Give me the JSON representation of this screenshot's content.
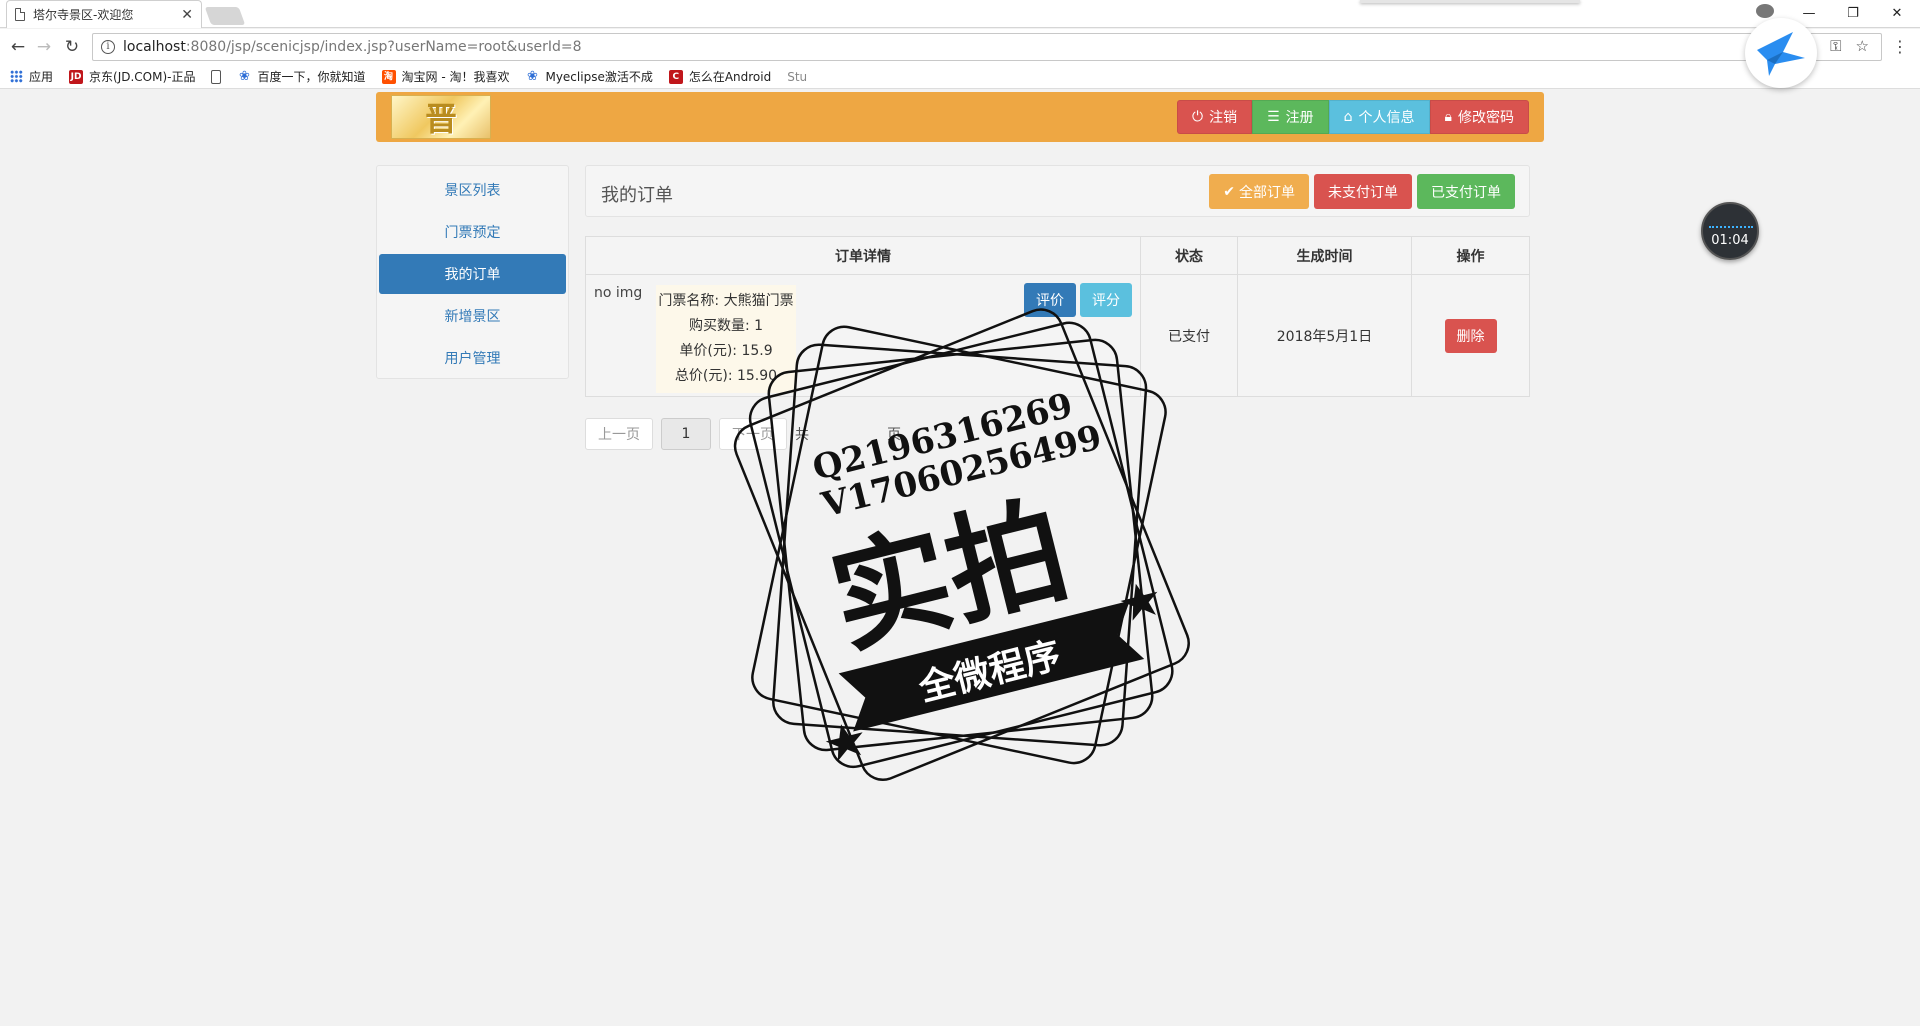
{
  "browser": {
    "tab_title": "塔尔寺景区-欢迎您",
    "url_host": "localhost",
    "url_rest": ":8080/jsp/scenicjsp/index.jsp?userName=root&userId=8",
    "bookmarks": [
      {
        "label": "应用",
        "icon": "apps-grid-icon",
        "color": "#2f6fd6"
      },
      {
        "label": "京东(JD.COM)-正品",
        "icon": "jd-icon",
        "color": "#c0161b"
      },
      {
        "label": "",
        "icon": "page-icon",
        "color": "#555555"
      },
      {
        "label": "百度一下，你就知道",
        "icon": "baidu-paw-icon",
        "color": "#2f6fd6"
      },
      {
        "label": "淘宝网 - 淘！我喜欢",
        "icon": "taobao-icon",
        "color": "#ff5000"
      },
      {
        "label": "Myeclipse激活不成",
        "icon": "baidu-paw-icon",
        "color": "#2f6fd6"
      },
      {
        "label": "怎么在Android",
        "icon": "c-icon",
        "color": "#c0161b"
      },
      {
        "label": "Stu",
        "icon": "",
        "color": ""
      }
    ]
  },
  "widgets": {
    "timer": "01:04"
  },
  "header": {
    "logo_text": "晋",
    "actions": [
      {
        "label": "注销",
        "icon": "power-icon",
        "style": "b-danger"
      },
      {
        "label": "注册",
        "icon": "list-icon",
        "style": "b-success"
      },
      {
        "label": "个人信息",
        "icon": "home-icon",
        "style": "b-info"
      },
      {
        "label": "修改密码",
        "icon": "lock-icon",
        "style": "b-danger"
      }
    ]
  },
  "sidebar": {
    "items": [
      {
        "label": "景区列表",
        "active": false
      },
      {
        "label": "门票预定",
        "active": false
      },
      {
        "label": "我的订单",
        "active": true
      },
      {
        "label": "新增景区",
        "active": false
      },
      {
        "label": "用户管理",
        "active": false
      }
    ]
  },
  "main": {
    "title": "我的订单",
    "filters": [
      {
        "label": "全部订单",
        "icon": "check-icon",
        "style": "b-warning"
      },
      {
        "label": "未支付订单",
        "icon": "",
        "style": "b-danger"
      },
      {
        "label": "已支付订单",
        "icon": "",
        "style": "b-success"
      }
    ],
    "table": {
      "headers": [
        "订单详情",
        "状态",
        "生成时间",
        "操作"
      ],
      "rows": [
        {
          "img_alt": "no img",
          "detail_lines": [
            "门票名称: 大熊猫门票",
            "购买数量: 1",
            "单价(元): 15.9",
            "总价(元): 15.90"
          ],
          "review_label": "评价",
          "rate_label": "评分",
          "status": "已支付",
          "created": "2018年5月1日",
          "delete_label": "删除"
        }
      ]
    },
    "pager": {
      "prev": "上一页",
      "current": "1",
      "next": "下一页",
      "total_prefix": "共",
      "total_suffix": "页"
    }
  },
  "watermark": {
    "line1": "Q2196316269",
    "line2": "V17060256499",
    "big": "实拍",
    "banner": "全微程序"
  }
}
